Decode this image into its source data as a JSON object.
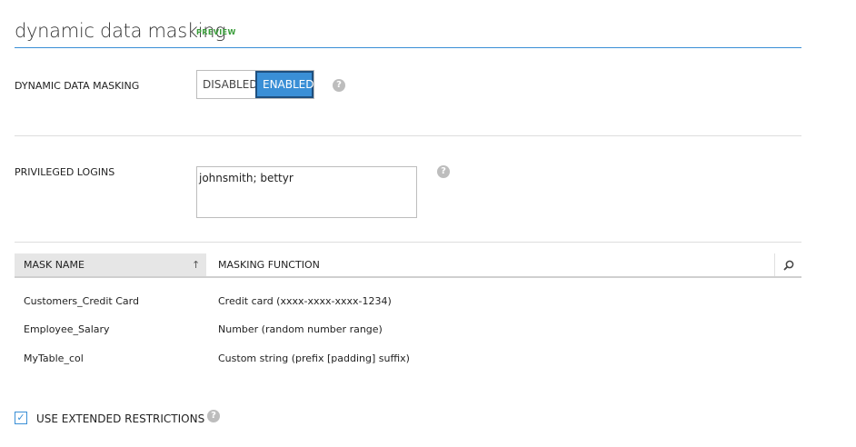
{
  "header": {
    "title": "dynamic data masking",
    "badge": "PREVIEW"
  },
  "masking_toggle": {
    "label": "DYNAMIC DATA MASKING",
    "options": [
      "DISABLED",
      "ENABLED"
    ],
    "selected": "ENABLED"
  },
  "privileged_logins": {
    "label": "PRIVILEGED LOGINS",
    "value": "johnsmith; bettyr"
  },
  "table": {
    "columns": [
      "MASK NAME",
      "MASKING FUNCTION"
    ],
    "sort_column": "MASK NAME",
    "rows": [
      {
        "name": "Customers_Credit Card",
        "function": "Credit card (xxxx-xxxx-xxxx-1234)"
      },
      {
        "name": "Employee_Salary",
        "function": "Number (random number range)"
      },
      {
        "name": "MyTable_col",
        "function": "Custom string (prefix [padding] suffix)"
      }
    ]
  },
  "extended_restrictions": {
    "label": "USE EXTENDED RESTRICTIONS",
    "checked": true
  },
  "icons": {
    "help": "question-mark-icon",
    "search": "search-icon",
    "sort": "sort-up-arrow-icon",
    "check": "checkmark-icon"
  },
  "colors": {
    "accent": "#3a8fd6",
    "preview": "#3a9e3a",
    "header_bg": "#e6e6e6"
  }
}
